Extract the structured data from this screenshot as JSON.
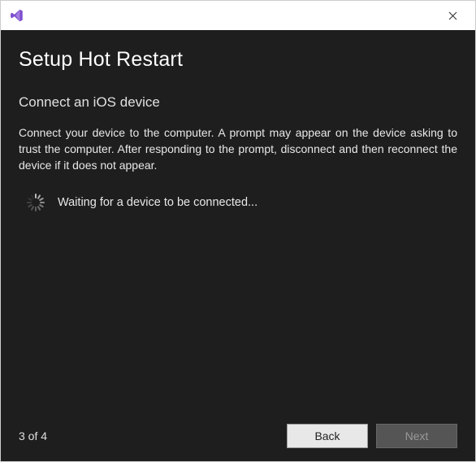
{
  "dialog": {
    "title": "Setup Hot Restart",
    "subtitle": "Connect an iOS device",
    "description": "Connect your device to the computer. A prompt may appear on the device asking to trust the computer. After responding to the prompt, disconnect and then reconnect the device if it does not appear.",
    "status_text": "Waiting for a device to be connected..."
  },
  "footer": {
    "step_label": "3 of 4",
    "back_label": "Back",
    "next_label": "Next",
    "next_enabled": false
  },
  "icons": {
    "close": "✕",
    "app": "visual-studio"
  },
  "colors": {
    "background": "#1e1e1e",
    "accent": "#7e57c2"
  }
}
